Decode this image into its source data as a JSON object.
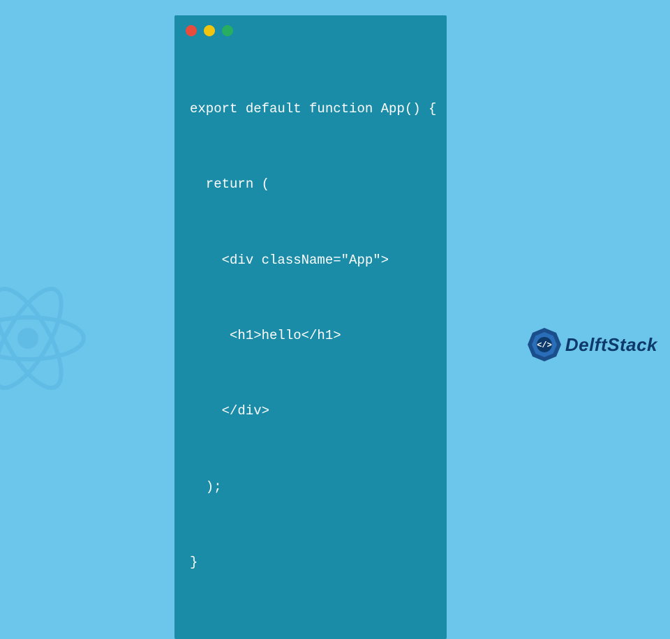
{
  "code": {
    "lines": [
      "export default function App() {",
      "  return (",
      "    <div className=\"App\">",
      "     <h1>hello</h1>",
      "    </div>",
      "  );",
      "}"
    ]
  },
  "brand": {
    "name": "DelftStack"
  },
  "colors": {
    "bg": "#6cc5eb",
    "window": "#1a8ca8",
    "dot_red": "#e74c3c",
    "dot_yellow": "#f1c40f",
    "dot_green": "#27ae60",
    "logo_text": "#0d3a6b"
  }
}
